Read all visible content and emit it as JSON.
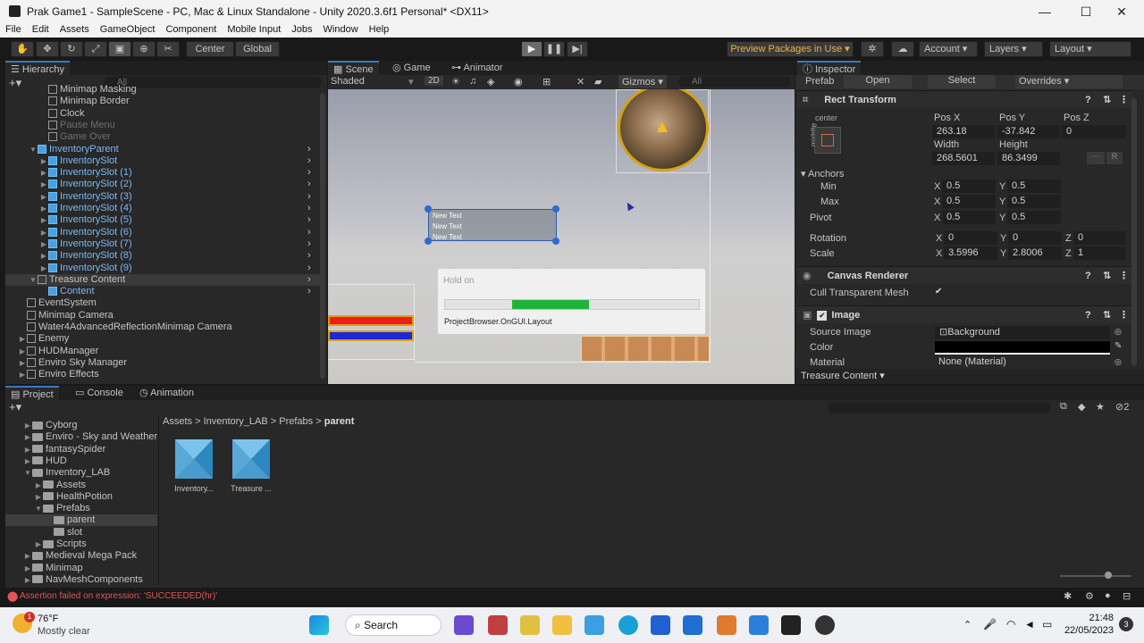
{
  "window": {
    "title": "Prak Game1 - SampleScene - PC, Mac & Linux Standalone - Unity 2020.3.6f1 Personal* <DX11>",
    "minimize": "—",
    "maximize": "☐",
    "close": "✕"
  },
  "menu": [
    "File",
    "Edit",
    "Assets",
    "GameObject",
    "Component",
    "Mobile Input",
    "Jobs",
    "Window",
    "Help"
  ],
  "toolbar": {
    "pivot": "Center",
    "space": "Global",
    "preview_packages": "Preview Packages in Use ▾",
    "account": "Account",
    "layers": "Layers",
    "layout": "Layout"
  },
  "hierarchy": {
    "tab": "Hierarchy",
    "search_placeholder": "All",
    "rows": [
      {
        "label": "Minimap Masking",
        "dim": false,
        "blue": false,
        "indent": 4
      },
      {
        "label": "Minimap Border",
        "dim": false,
        "blue": false,
        "indent": 4
      },
      {
        "label": "Clock",
        "dim": false,
        "blue": false,
        "indent": 4
      },
      {
        "label": "Pause Menu",
        "dim": true,
        "blue": false,
        "indent": 4
      },
      {
        "label": "Game Over",
        "dim": true,
        "blue": false,
        "indent": 4
      },
      {
        "label": "InventoryParent",
        "dim": false,
        "blue": true,
        "indent": 3
      },
      {
        "label": "InventorySlot",
        "dim": false,
        "blue": true,
        "indent": 4
      },
      {
        "label": "InventorySlot (1)",
        "dim": false,
        "blue": true,
        "indent": 4
      },
      {
        "label": "InventorySlot (2)",
        "dim": false,
        "blue": true,
        "indent": 4
      },
      {
        "label": "InventorySlot (3)",
        "dim": false,
        "blue": true,
        "indent": 4
      },
      {
        "label": "InventorySlot (4)",
        "dim": false,
        "blue": true,
        "indent": 4
      },
      {
        "label": "InventorySlot (5)",
        "dim": false,
        "blue": true,
        "indent": 4
      },
      {
        "label": "InventorySlot (6)",
        "dim": false,
        "blue": true,
        "indent": 4
      },
      {
        "label": "InventorySlot (7)",
        "dim": false,
        "blue": true,
        "indent": 4
      },
      {
        "label": "InventorySlot (8)",
        "dim": false,
        "blue": true,
        "indent": 4
      },
      {
        "label": "InventorySlot (9)",
        "dim": false,
        "blue": true,
        "indent": 4
      },
      {
        "label": "Treasure Content",
        "dim": false,
        "blue": false,
        "indent": 3
      },
      {
        "label": "Content",
        "dim": false,
        "blue": true,
        "indent": 4
      },
      {
        "label": "EventSystem",
        "dim": false,
        "blue": false,
        "indent": 2
      },
      {
        "label": "Minimap Camera",
        "dim": false,
        "blue": false,
        "indent": 2
      },
      {
        "label": "Water4AdvancedReflectionMinimap Camera",
        "dim": false,
        "blue": false,
        "indent": 2
      },
      {
        "label": "Enemy",
        "dim": false,
        "blue": false,
        "indent": 2
      },
      {
        "label": "HUDManager",
        "dim": false,
        "blue": false,
        "indent": 2
      },
      {
        "label": "Enviro Sky Manager",
        "dim": false,
        "blue": false,
        "indent": 2
      },
      {
        "label": "Enviro Effects",
        "dim": false,
        "blue": false,
        "indent": 2
      }
    ]
  },
  "scene": {
    "tabs": [
      "Scene",
      "Game",
      "Animator"
    ],
    "shading": "Shaded",
    "mode2d": "2D",
    "gizmos": "Gizmos",
    "search_placeholder": "All",
    "texts": [
      "New Text",
      "New Text",
      "New Text"
    ]
  },
  "dialog": {
    "title": "Hold on",
    "message": "ProjectBrowser.OnGUI.Layout",
    "progress": 0.3
  },
  "inspector": {
    "tab": "Inspector",
    "prefab_label": "Prefab",
    "open": "Open",
    "select": "Select",
    "overrides": "Overrides",
    "rect_transform": "Rect Transform",
    "anchor_label": "center",
    "anchor_side": "middle",
    "pos_x_label": "Pos X",
    "pos_y_label": "Pos Y",
    "pos_z_label": "Pos Z",
    "pos_x": "263.18",
    "pos_y": "-37.842",
    "pos_z": "0",
    "width_label": "Width",
    "height_label": "Height",
    "width": "268.5601",
    "height": "86.3499",
    "anchors": "Anchors",
    "min": "Min",
    "max": "Max",
    "min_x": "0.5",
    "min_y": "0.5",
    "max_x": "0.5",
    "max_y": "0.5",
    "pivot": "Pivot",
    "pivot_x": "0.5",
    "pivot_y": "0.5",
    "rotation": "Rotation",
    "rot_x": "0",
    "rot_y": "0",
    "rot_z": "0",
    "scale": "Scale",
    "scale_x": "3.5996",
    "scale_y": "2.8006",
    "scale_z": "1",
    "x": "X",
    "y": "Y",
    "z": "Z",
    "canvas_renderer": "Canvas Renderer",
    "cull": "Cull Transparent Mesh",
    "image": "Image",
    "source_image_label": "Source Image",
    "source_image": "Background",
    "color_label": "Color",
    "material_label": "Material",
    "material": "None (Material)",
    "footer": "Treasure Content ▾"
  },
  "bottom": {
    "tabs": [
      "Project",
      "Console",
      "Animation"
    ],
    "breadcrumb": [
      "Assets",
      "Inventory_LAB",
      "Prefabs",
      "parent"
    ],
    "tree": [
      {
        "label": "Cyborg",
        "indent": 1
      },
      {
        "label": "Enviro - Sky and Weather",
        "indent": 1
      },
      {
        "label": "fantasySpider",
        "indent": 1
      },
      {
        "label": "HUD",
        "indent": 1
      },
      {
        "label": "Inventory_LAB",
        "indent": 1
      },
      {
        "label": "Assets",
        "indent": 2
      },
      {
        "label": "HealthPotion",
        "indent": 2
      },
      {
        "label": "Prefabs",
        "indent": 2
      },
      {
        "label": "parent",
        "indent": 3
      },
      {
        "label": "slot",
        "indent": 3
      },
      {
        "label": "Scripts",
        "indent": 2
      },
      {
        "label": "Medieval Mega Pack",
        "indent": 1
      },
      {
        "label": "Minimap",
        "indent": 1
      },
      {
        "label": "NavMeshComponents",
        "indent": 1
      }
    ],
    "assets": [
      "Inventory...",
      "Treasure ..."
    ],
    "status_error": "Assertion failed on expression: 'SUCCEEDED(hr)'",
    "hidden_count": "2"
  },
  "taskbar": {
    "temp": "76°F",
    "weather": "Mostly clear",
    "search": "Search",
    "time": "21:48",
    "date": "22/05/2023",
    "badge": "3",
    "weather_badge": "1"
  }
}
